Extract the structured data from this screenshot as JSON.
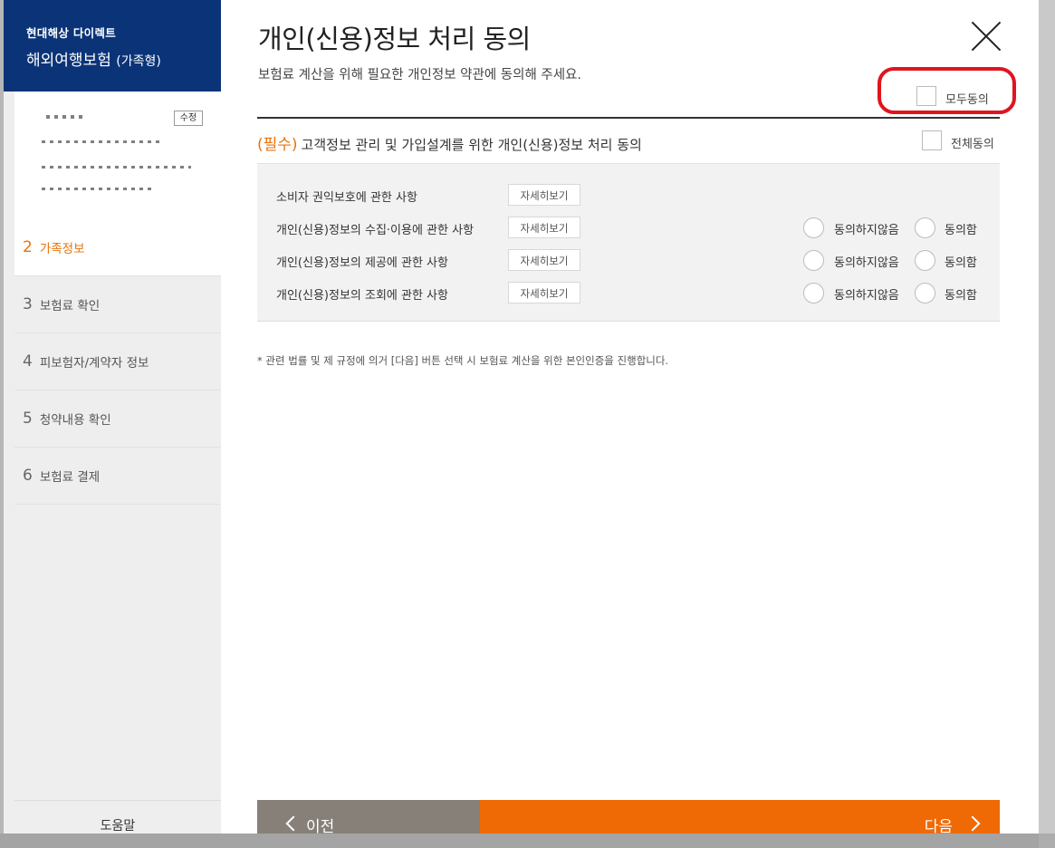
{
  "brand": {
    "company": "현대해상 다이렉트",
    "product": "해외여행보험",
    "product_sub": "(가족형)"
  },
  "info": {
    "edit_label": "수정"
  },
  "steps": [
    {
      "num": "2",
      "label": "가족정보"
    },
    {
      "num": "3",
      "label": "보험료 확인"
    },
    {
      "num": "4",
      "label": "피보험자/계약자 정보"
    },
    {
      "num": "5",
      "label": "청약내용 확인"
    },
    {
      "num": "6",
      "label": "보험료 결제"
    }
  ],
  "help_label": "도움말",
  "page": {
    "title": "개인(신용)정보 처리 동의",
    "subtitle": "보험료 계산을 위해 필요한 개인정보 약관에 동의해 주세요.",
    "all_agree_label": "모두동의"
  },
  "section": {
    "required_tag": "(필수)",
    "title": "고객정보 관리 및 가입설계를 위한 개인(신용)정보 처리 동의",
    "check_label": "전체동의"
  },
  "items": [
    {
      "label": "소비자 권익보호에 관한 사항",
      "detail": "자세히보기"
    },
    {
      "label": "개인(신용)정보의 수집·이용에 관한 사항",
      "detail": "자세히보기",
      "disagree": "동의하지않음",
      "agree": "동의함"
    },
    {
      "label": "개인(신용)정보의 제공에 관한 사항",
      "detail": "자세히보기",
      "disagree": "동의하지않음",
      "agree": "동의함"
    },
    {
      "label": "개인(신용)정보의 조회에 관한 사항",
      "detail": "자세히보기",
      "disagree": "동의하지않음",
      "agree": "동의함"
    }
  ],
  "note": "* 관련 법률 및 제 규정에 의거 [다음] 버튼 선택 시 보험료 계산을 위한 본인인증을 진행합니다.",
  "buttons": {
    "prev": "이전",
    "next": "다음"
  },
  "colors": {
    "brand": "#0b3478",
    "accent": "#ef6a05",
    "highlight": "#e0141e"
  }
}
